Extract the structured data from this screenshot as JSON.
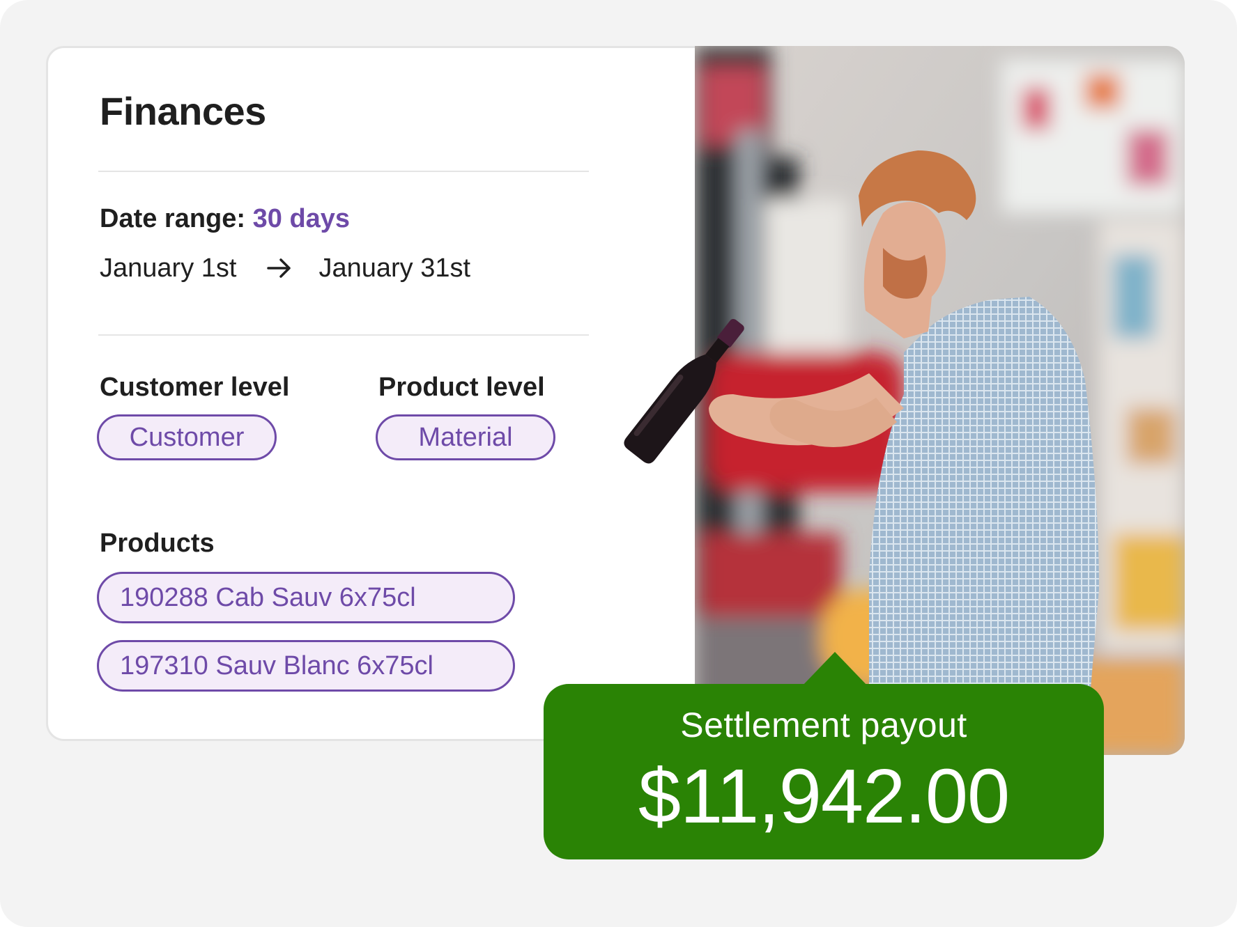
{
  "card": {
    "title": "Finances",
    "date_range": {
      "label": "Date range:",
      "value": "30 days",
      "start": "January 1st",
      "end": "January 31st"
    },
    "customer_level": {
      "label": "Customer level",
      "chip": "Customer"
    },
    "product_level": {
      "label": "Product level",
      "chip": "Material"
    },
    "products": {
      "label": "Products",
      "items": [
        "190288 Cab Sauv 6x75cl",
        "197310 Sauv Blanc 6x75cl"
      ]
    }
  },
  "payout": {
    "label": "Settlement payout",
    "amount": "$11,942.00"
  },
  "icons": {
    "arrow": "arrow-right-icon"
  },
  "colors": {
    "accent_purple": "#6e4aa8",
    "chip_fill": "#f4ecf9",
    "payout_green": "#2a8305",
    "page_background": "#f3f3f3"
  }
}
